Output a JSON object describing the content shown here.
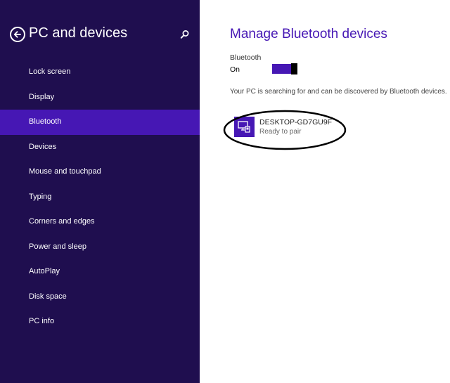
{
  "nav": {
    "title": "PC and devices",
    "back_icon": "back-arrow-icon",
    "search_icon": "search-icon",
    "items": [
      {
        "label": "Lock screen",
        "selected": false
      },
      {
        "label": "Display",
        "selected": false
      },
      {
        "label": "Bluetooth",
        "selected": true
      },
      {
        "label": "Devices",
        "selected": false
      },
      {
        "label": "Mouse and touchpad",
        "selected": false
      },
      {
        "label": "Typing",
        "selected": false
      },
      {
        "label": "Corners and edges",
        "selected": false
      },
      {
        "label": "Power and sleep",
        "selected": false
      },
      {
        "label": "AutoPlay",
        "selected": false
      },
      {
        "label": "Disk space",
        "selected": false
      },
      {
        "label": "PC info",
        "selected": false
      }
    ]
  },
  "main": {
    "title": "Manage Bluetooth devices",
    "bluetooth_label": "Bluetooth",
    "bluetooth_state": "On",
    "bluetooth_on": true,
    "status": "Your PC is searching for and can be discovered by Bluetooth devices.",
    "devices": [
      {
        "name": "DESKTOP-GD7GU9F",
        "status": "Ready to pair",
        "icon": "computer-device-icon"
      }
    ]
  },
  "colors": {
    "nav_background": "#1f0e4f",
    "accent": "#4617b4",
    "content_background": "#ffffff"
  }
}
